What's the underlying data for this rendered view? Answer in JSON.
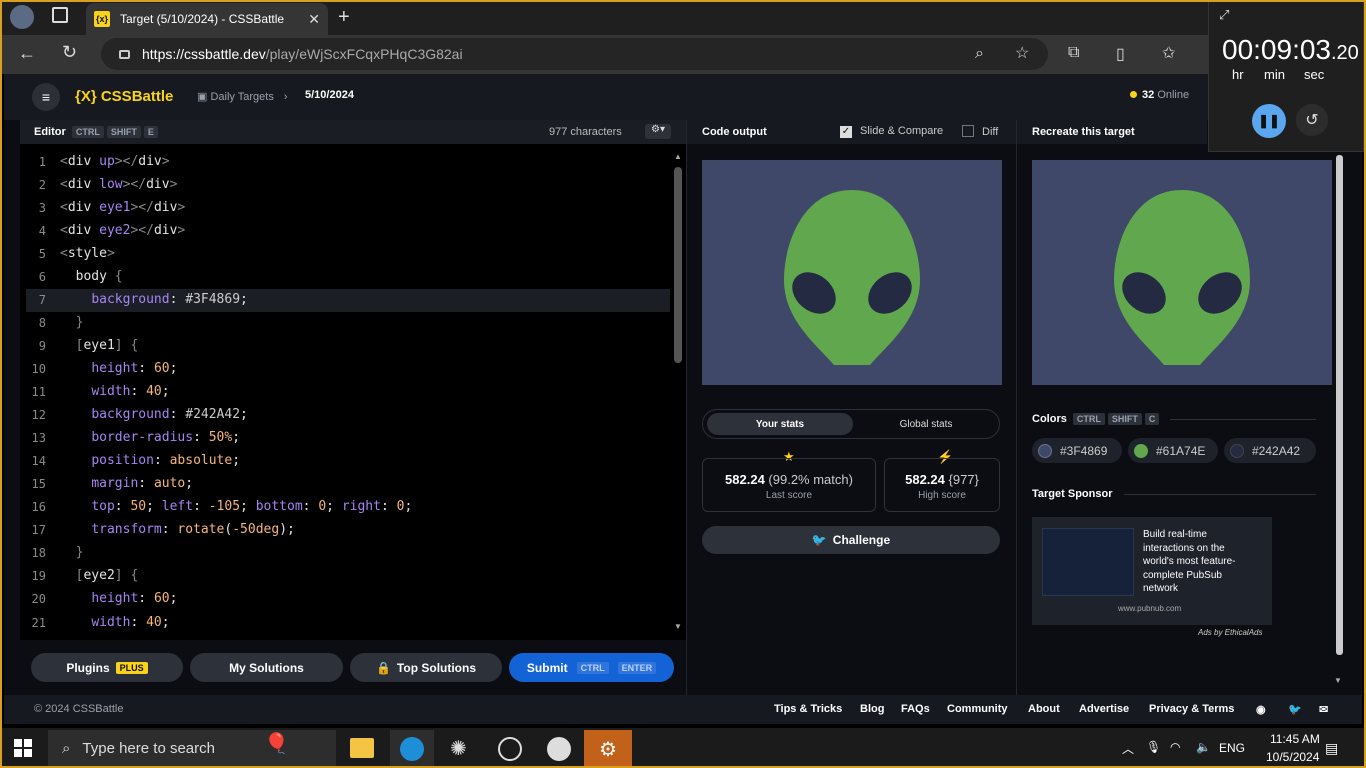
{
  "browser": {
    "tab_title": "Target (5/10/2024) - CSSBattle",
    "url_host": "https://cssbattle.dev",
    "url_path": "/play/eWjScxFCqxPHqC3G82ai"
  },
  "nav": {
    "logo": "{X} CSSBattle",
    "crumb1": "Daily Targets",
    "crumb2": "5/10/2024",
    "online_count": "32",
    "online_label": "Online"
  },
  "editor": {
    "label": "Editor",
    "kbd": [
      "CTRL",
      "SHIFT",
      "E"
    ],
    "char_count": "977 characters",
    "line_numbers": [
      "1",
      "2",
      "3",
      "4",
      "5",
      "6",
      "7",
      "8",
      "9",
      "10",
      "11",
      "12",
      "13",
      "14",
      "15",
      "16",
      "17",
      "18",
      "19",
      "20",
      "21"
    ]
  },
  "buttons": {
    "plugins": "Plugins",
    "plus": "PLUS",
    "my_solutions": "My Solutions",
    "top_solutions": "Top Solutions",
    "submit": "Submit",
    "submit_k1": "CTRL",
    "submit_k2": "ENTER"
  },
  "output": {
    "title": "Code output",
    "slide": "Slide & Compare",
    "diff": "Diff"
  },
  "stats": {
    "tab_your": "Your stats",
    "tab_global": "Global stats",
    "last_value": "582.24",
    "last_match": "(99.2% match)",
    "last_label": "Last score",
    "high_value": "582.24",
    "high_chars": "{977}",
    "high_label": "High score",
    "challenge": "Challenge"
  },
  "target": {
    "title": "Recreate this target",
    "colors_label": "Colors",
    "colors_kbd": [
      "CTRL",
      "SHIFT",
      "C"
    ],
    "colors": [
      {
        "hex": "#3F4869",
        "label": "#3F4869"
      },
      {
        "hex": "#61A74E",
        "label": "#61A74E"
      },
      {
        "hex": "#242A42",
        "label": "#242A42"
      }
    ],
    "sponsor_label": "Target Sponsor",
    "sponsor_text": "Build real-time interactions on the world's most feature-complete PubSub network",
    "sponsor_url": "www.pubnub.com",
    "ads_by": "Ads by EthicalAds"
  },
  "footer": {
    "copyright": "© 2024 CSSBattle",
    "links": [
      "Tips & Tricks",
      "Blog",
      "FAQs",
      "Community",
      "About",
      "Advertise",
      "Privacy & Terms"
    ]
  },
  "timer": {
    "time": "00:09:03",
    "fraction": ".20",
    "hr": "hr",
    "min": "min",
    "sec": "sec"
  },
  "taskbar": {
    "search_placeholder": "Type here to search",
    "lang": "ENG",
    "time": "11:45 AM",
    "date": "10/5/2024"
  },
  "colors": {
    "bg": "#3F4869",
    "alien": "#61A74E",
    "eye": "#242A42",
    "accent": "#F9D21C",
    "submit": "#1463D6"
  }
}
